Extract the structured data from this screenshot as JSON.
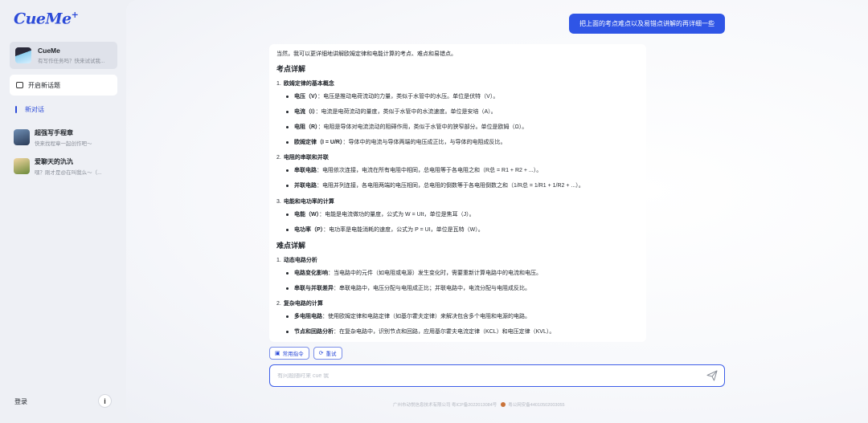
{
  "app": {
    "logo_text": "CueMe",
    "logo_mark": "+"
  },
  "sidebar": {
    "agent": {
      "name": "CueMe",
      "subtitle": "有写作任务吗？快来试试我..."
    },
    "new_topic_label": "开启新话题",
    "active_chat_label": "新对话",
    "history": [
      {
        "title": "超强写手程章",
        "subtitle": "快来找程章一起创作吧～"
      },
      {
        "title": "爱聊天的氿氿",
        "subtitle": "嘿？刚才是@在叫我么～（..."
      }
    ],
    "login_label": "登录",
    "info_icon_label": "i"
  },
  "chat": {
    "user_message": "把上面的考点难点以及易错点讲解的再详细一些",
    "answer": {
      "intro": "当然，我可以更详细地讲解欧姆定律和电能计算的考点、难点和易错点。",
      "sections": [
        {
          "heading": "考点详解",
          "groups": [
            {
              "num": "1.",
              "title": "欧姆定律的基本概念",
              "items": [
                {
                  "term": "电压（V）",
                  "text": "：电压是推动电荷流动的力量，类似于水管中的水压。单位是伏特（V）。"
                },
                {
                  "term": "电流（I）",
                  "text": "：电流是电荷流动的量度，类似于水管中的水流速度。单位是安培（A）。"
                },
                {
                  "term": "电阻（R）",
                  "text": "：电阻是导体对电流流动的阻碍作用，类似于水管中的狭窄部分。单位是欧姆（Ω）。"
                },
                {
                  "term": "欧姆定律（I = U/R）",
                  "text": "：导体中的电流与导体两端的电压成正比，与导体的电阻成反比。"
                }
              ]
            },
            {
              "num": "2.",
              "title": "电阻的串联和并联",
              "items": [
                {
                  "term": "串联电路",
                  "text": "：电阻依次连接，电流在所有电阻中相同，总电阻等于各电阻之和（R总 = R1 + R2 + ...）。"
                },
                {
                  "term": "并联电路",
                  "text": "：电阻并列连接，各电阻两端的电压相同，总电阻的倒数等于各电阻倒数之和（1/R总 = 1/R1 + 1/R2 + ...）。"
                }
              ]
            },
            {
              "num": "3.",
              "title": "电能和电功率的计算",
              "items": [
                {
                  "term": "电能（W）",
                  "text": "：电能是电流做功的量度，公式为 W = UIt，单位是焦耳（J）。"
                },
                {
                  "term": "电功率（P）",
                  "text": "：电功率是电能消耗的速度，公式为 P = UI，单位是瓦特（W）。"
                }
              ]
            }
          ]
        },
        {
          "heading": "难点详解",
          "groups": [
            {
              "num": "1.",
              "title": "动态电路分析",
              "items": [
                {
                  "term": "电路变化影响",
                  "text": "：当电路中的元件（如电阻或电源）发生变化时，需要重新计算电路中的电流和电压。"
                },
                {
                  "term": "串联与并联差异",
                  "text": "：串联电路中，电压分配与电阻成正比；并联电路中，电流分配与电阻成反比。"
                }
              ]
            },
            {
              "num": "2.",
              "title": "复杂电路的计算",
              "items": [
                {
                  "term": "多电阻电路",
                  "text": "：使用欧姆定律和电路定律（如基尔霍夫定律）来解决包含多个电阻和电源的电路。"
                },
                {
                  "term": "节点和回路分析",
                  "text": "：在复杂电路中，识别节点和回路，应用基尔霍夫电流定律（KCL）和电压定律（KVL）。"
                }
              ]
            }
          ]
        }
      ]
    },
    "chips": [
      {
        "icon": "▣",
        "label": "常用指令"
      },
      {
        "icon": "⟳",
        "label": "重试"
      }
    ],
    "input_placeholder": "有问题随时来 cue 我"
  },
  "footer": {
    "icp": "广州市动悦信息技术有限公司 粤ICP备2022013084号",
    "police": "粤公网安备44010502003055"
  },
  "colors": {
    "accent": "#2f55e6",
    "sidebar_bg": "#eef0f5",
    "card_bg": "#ffffff"
  }
}
